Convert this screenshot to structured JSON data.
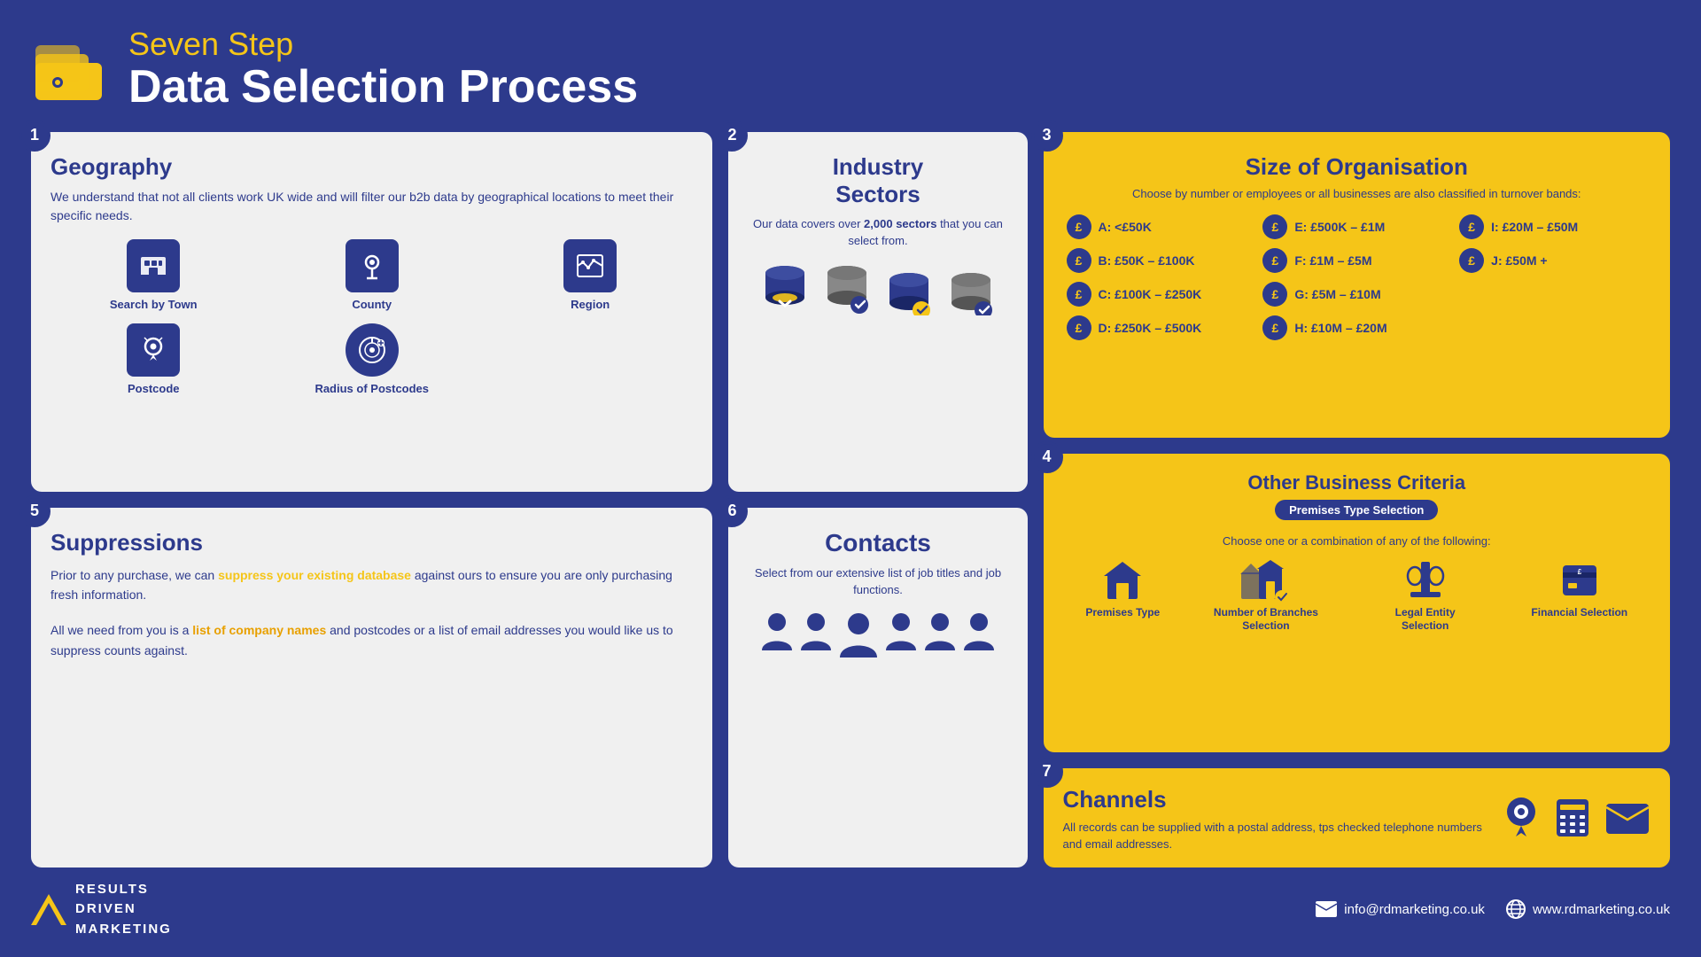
{
  "header": {
    "subtitle": "Seven Step",
    "title": "Data Selection Process"
  },
  "steps": {
    "geography": {
      "number": "1",
      "title": "Geography",
      "description": "We understand that not all clients work UK wide and will filter our b2b data by geographical locations to meet their specific needs.",
      "icons": [
        {
          "label": "Search by Town",
          "icon": "🏙"
        },
        {
          "label": "County",
          "icon": "📍"
        },
        {
          "label": "Region",
          "icon": "🗺"
        },
        {
          "label": "Postcode",
          "icon": "📮"
        },
        {
          "label": "Radius of Postcodes",
          "icon": "🎯"
        }
      ]
    },
    "industry": {
      "number": "2",
      "title": "Industry Sectors",
      "description": "Our data covers over 2,000 sectors that you can select from."
    },
    "size": {
      "number": "3",
      "title": "Size of Organisation",
      "subtitle": "Choose by number or employees or all businesses are also classified in turnover bands:",
      "bands": [
        {
          "code": "A",
          "label": "A: <£50K"
        },
        {
          "code": "B",
          "label": "B: £50K – £100K"
        },
        {
          "code": "C",
          "label": "C: £100K – £250K"
        },
        {
          "code": "D",
          "label": "D: £250K – £500K"
        },
        {
          "code": "E",
          "label": "E: £500K – £1M"
        },
        {
          "code": "F",
          "label": "F: £1M – £5M"
        },
        {
          "code": "G",
          "label": "G: £5M – £10M"
        },
        {
          "code": "H",
          "label": "H: £10M – £20M"
        },
        {
          "code": "I",
          "label": "I: £20M – £50M"
        },
        {
          "code": "J",
          "label": "J: £50M +"
        }
      ]
    },
    "other_biz": {
      "number": "4",
      "title": "Other Business Criteria",
      "badge": "Premises Type Selection",
      "subtitle": "Choose one or a combination of any of the following:",
      "criteria": [
        {
          "label": "Premises Type",
          "icon": "🏢"
        },
        {
          "label": "Number of Branches Selection",
          "icon": "🏬"
        },
        {
          "label": "Legal Entity Selection",
          "icon": "⚖"
        },
        {
          "label": "Financial Selection",
          "icon": "💷"
        }
      ]
    },
    "suppressions": {
      "number": "5",
      "title": "Suppressions",
      "para1": "Prior to any purchase, we can suppress your existing database against ours to ensure you are only purchasing fresh information.",
      "para2_before": "All we need from you is a ",
      "para2_highlight": "list of company names",
      "para2_after": " and postcodes or a list of email addresses you would like us to suppress counts against."
    },
    "contacts": {
      "number": "6",
      "title": "Contacts",
      "description": "Select from our extensive list of job titles and job functions."
    },
    "channels": {
      "number": "7",
      "title": "Channels",
      "description": "All records can be supplied with a postal address, tps checked telephone numbers and email addresses."
    }
  },
  "footer": {
    "logo_lines": [
      "RESULTS",
      "DRIVEN",
      "MARKETING"
    ],
    "email": "info@rdmarketing.co.uk",
    "website": "www.rdmarketing.co.uk"
  }
}
